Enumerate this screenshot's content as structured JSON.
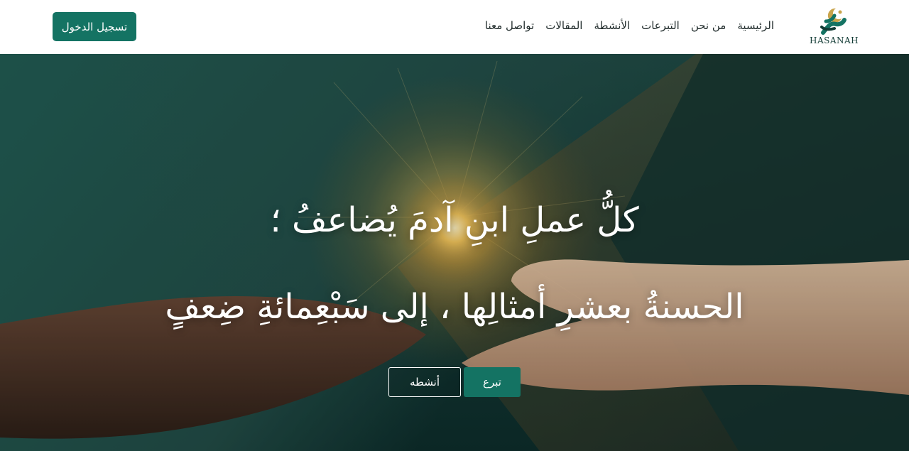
{
  "brand": {
    "name": "HASANAH",
    "logo_icon": "crescent-hand-logo-icon"
  },
  "nav": {
    "items": [
      {
        "label": "الرئيسية"
      },
      {
        "label": "من نحن"
      },
      {
        "label": "التبرعات"
      },
      {
        "label": "الأنشطة"
      },
      {
        "label": "المقالات"
      },
      {
        "label": "تواصل معنا"
      }
    ],
    "login_label": "تسجيل الدخول"
  },
  "hero": {
    "line1": "كلُّ عملِ ابنِ آدمَ يُضاعفُ ؛",
    "line2": "الحسنةُ بعشرِ أمثالِها ، إلى سَبْعِمائةِ ضِعفٍ",
    "donate_label": "تبرع",
    "activities_label": "أنشطه",
    "background": "two-hands-glowing-orb-image"
  },
  "colors": {
    "primary": "#147363",
    "hero_dark": "#0d2d2b",
    "glow": "#f5c65a"
  }
}
